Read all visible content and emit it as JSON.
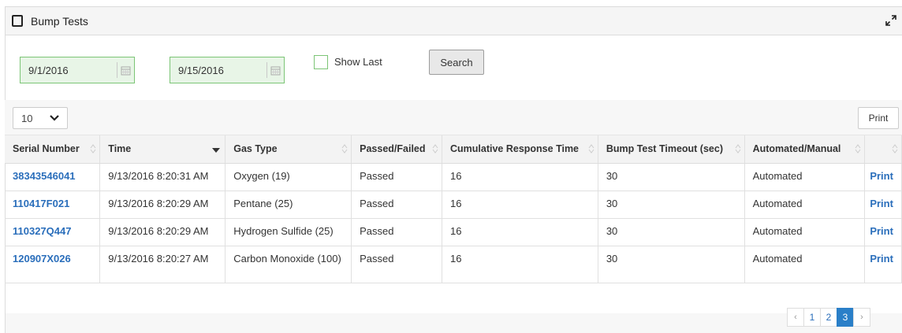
{
  "panel": {
    "title": "Bump Tests"
  },
  "filters": {
    "start_date": "9/1/2016",
    "end_date": "9/15/2016",
    "show_last_label": "Show Last",
    "show_last_checked": false,
    "search_label": "Search"
  },
  "toolbar": {
    "page_size": "10",
    "print_label": "Print"
  },
  "table": {
    "headers": [
      "Serial Number",
      "Time",
      "Gas Type",
      "Passed/Failed",
      "Cumulative Response Time",
      "Bump Test Timeout (sec)",
      "Automated/Manual",
      ""
    ],
    "rows": [
      [
        "38343546041",
        "9/13/2016 8:20:31 AM",
        "Oxygen (19)",
        "Passed",
        "16",
        "30",
        "Automated",
        "Print"
      ],
      [
        "110417F021",
        "9/13/2016 8:20:29 AM",
        "Pentane (25)",
        "Passed",
        "16",
        "30",
        "Automated",
        "Print"
      ],
      [
        "110327Q447",
        "9/13/2016 8:20:29 AM",
        "Hydrogen Sulfide (25)",
        "Passed",
        "16",
        "30",
        "Automated",
        "Print"
      ],
      [
        "120907X026",
        "9/13/2016 8:20:27 AM",
        "Carbon Monoxide (100)",
        "Passed",
        "16",
        "30",
        "Automated",
        "Print"
      ]
    ]
  },
  "pagination": {
    "prev": "‹",
    "pages": [
      "1",
      "2",
      "3"
    ],
    "active": "3",
    "next": "›"
  },
  "colors": {
    "link": "#2a6ebb",
    "field_border": "#7cc576",
    "field_bg": "#e8f5e7",
    "active_page": "#2a7fc8"
  }
}
